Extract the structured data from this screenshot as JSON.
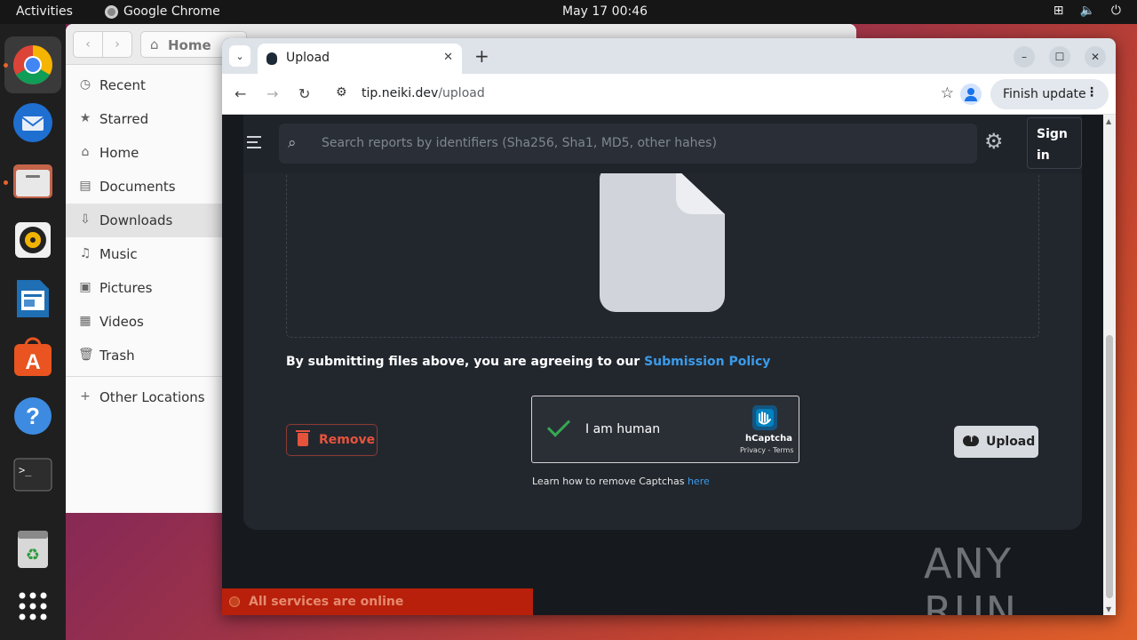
{
  "topbar": {
    "activities": "Activities",
    "app_name": "Google Chrome",
    "clock": "May 17  00:46"
  },
  "dock": {
    "apps": [
      "chrome-icon",
      "thunderbird-icon",
      "files-icon",
      "rhythmbox-icon",
      "writer-icon",
      "app-center-icon",
      "help-icon",
      "terminal-icon",
      "trash-icon",
      "app-grid-icon"
    ]
  },
  "files": {
    "path": "Home",
    "sidebar": [
      {
        "label": "Recent",
        "icon": "clock-icon"
      },
      {
        "label": "Starred",
        "icon": "star-icon"
      },
      {
        "label": "Home",
        "icon": "home-icon"
      },
      {
        "label": "Documents",
        "icon": "document-icon"
      },
      {
        "label": "Downloads",
        "icon": "download-icon",
        "selected": true
      },
      {
        "label": "Music",
        "icon": "music-icon"
      },
      {
        "label": "Pictures",
        "icon": "picture-icon"
      },
      {
        "label": "Videos",
        "icon": "video-icon"
      },
      {
        "label": "Trash",
        "icon": "trash-icon"
      },
      {
        "label": "Other Locations",
        "icon": "plus-icon"
      }
    ]
  },
  "chrome": {
    "tab_title": "Upload",
    "url_host": "tip.neiki.dev",
    "url_path": "/upload",
    "finish_update": "Finish update"
  },
  "page": {
    "search_placeholder": "Search reports by identifiers (Sha256, Sha1, MD5, other hahes)",
    "sign_in": "Sign in",
    "policy_text": "By submitting files above, you are agreeing to our ",
    "policy_link": "Submission Policy",
    "remove_label": "Remove",
    "upload_label": "Upload",
    "captcha": {
      "label": "I am human",
      "brand": "hCaptcha",
      "legal": "Privacy - Terms",
      "help_text": "Learn how to remove Captchas ",
      "help_link": "here"
    },
    "status": "All services are online",
    "watermark": "ANY RUN"
  },
  "colors": {
    "accent_link": "#3b9bea",
    "danger": "#e5533d",
    "status_bar": "#b8200b",
    "captcha_check": "#36a852"
  }
}
